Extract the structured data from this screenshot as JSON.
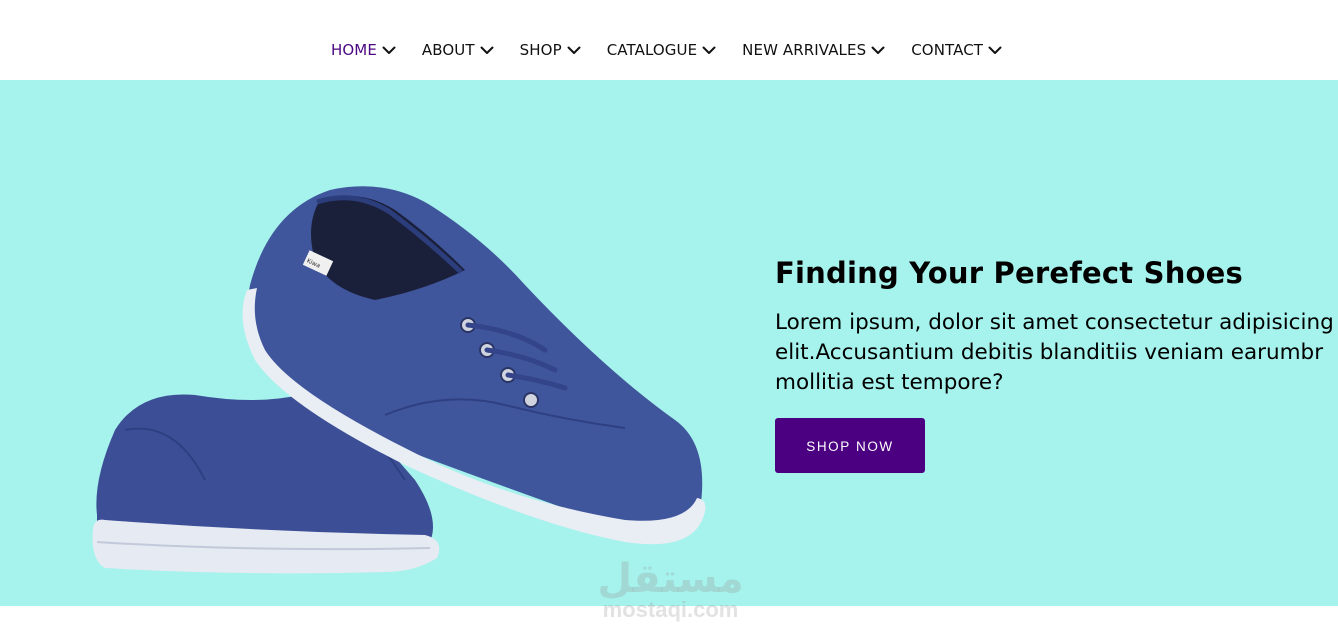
{
  "nav": {
    "items": [
      {
        "label": "HOME",
        "active": true
      },
      {
        "label": "ABOUT",
        "active": false
      },
      {
        "label": "SHOP",
        "active": false
      },
      {
        "label": "CATALOGUE",
        "active": false
      },
      {
        "label": "NEW ARRIVALES",
        "active": false
      },
      {
        "label": "CONTACT",
        "active": false
      }
    ],
    "dropdown_icon": "chevron-down-icon",
    "active_color": "#4b0882"
  },
  "hero": {
    "background_color": "#a6f2ec",
    "title": "Finding Your Perefect Shoes",
    "description": "Lorem ipsum, dolor sit amet consectetur adipisicing elit.Accusantium debitis blanditiis veniam earumbr mollitia est tempore?",
    "cta_label": "SHOP NOW",
    "cta_color": "#4b0082",
    "shoe_tag": "Kiwa"
  },
  "watermark": {
    "arabic": "مستقل",
    "latin": "mostaqi.com"
  }
}
